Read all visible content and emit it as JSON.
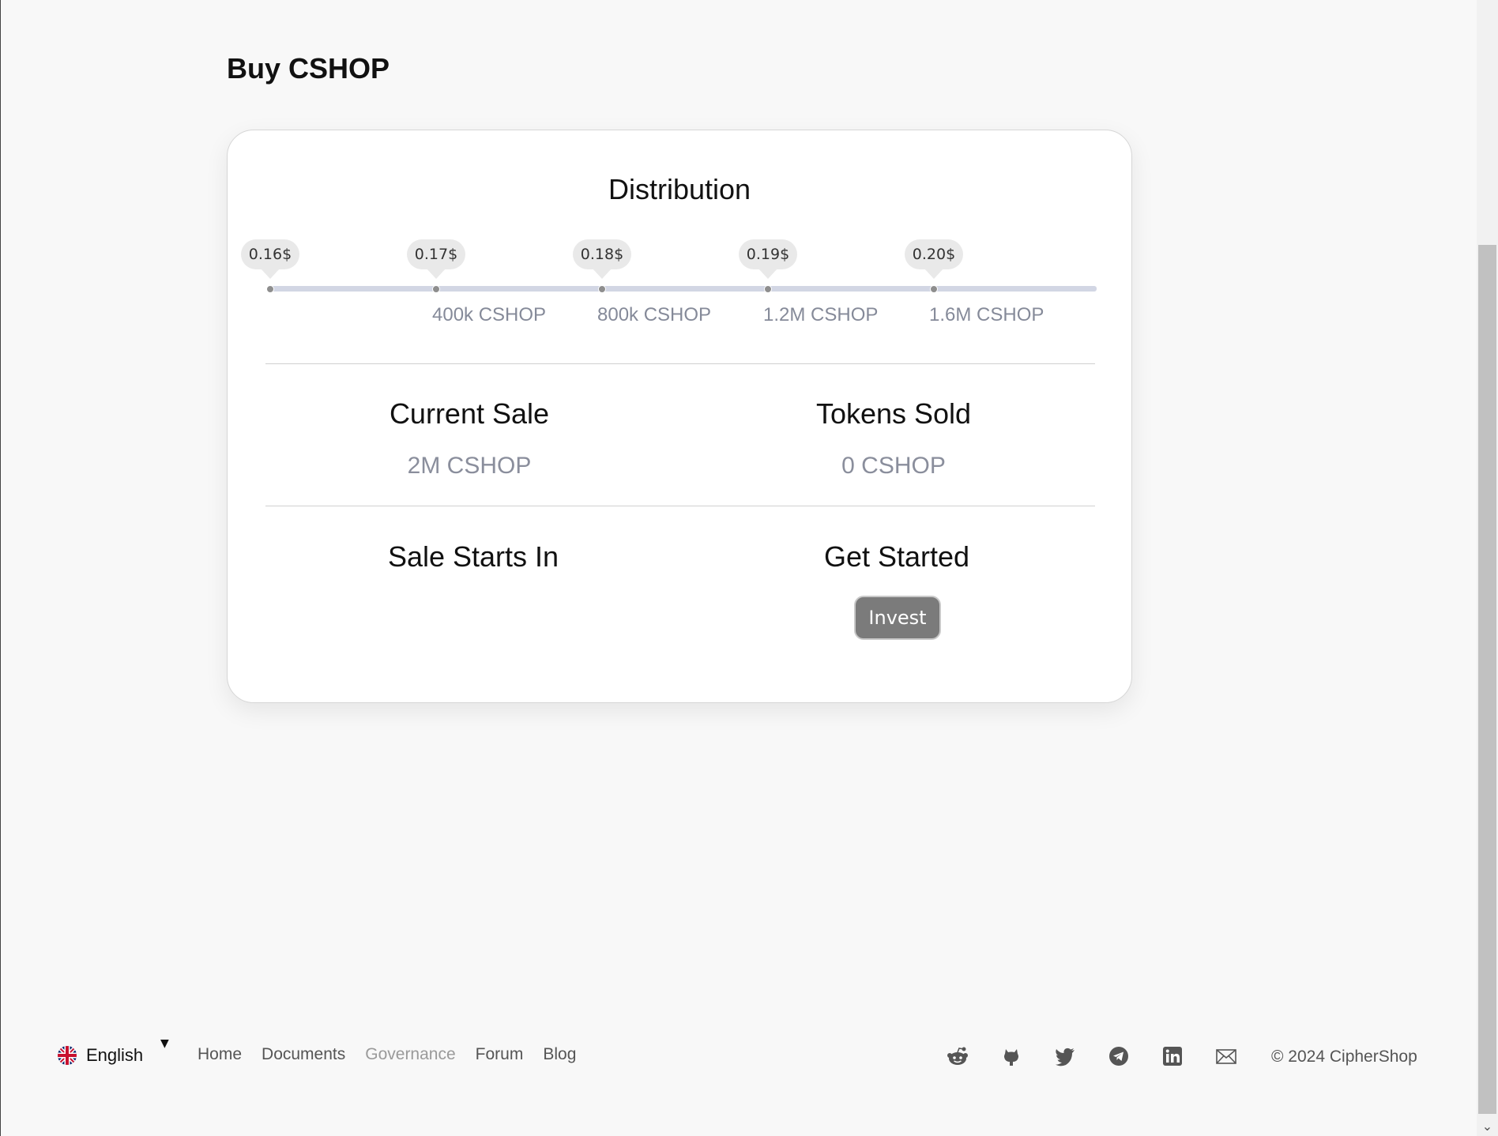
{
  "page": {
    "title": "Buy CSHOP"
  },
  "distribution": {
    "title": "Distribution",
    "stops": [
      {
        "price": "0.16$",
        "label": ""
      },
      {
        "price": "0.17$",
        "label": "400k CSHOP"
      },
      {
        "price": "0.18$",
        "label": "800k CSHOP"
      },
      {
        "price": "0.19$",
        "label": "1.2M CSHOP"
      },
      {
        "price": "0.20$",
        "label": "1.6M CSHOP"
      }
    ]
  },
  "stats": {
    "current_sale": {
      "heading": "Current Sale",
      "value": "2M CSHOP"
    },
    "tokens_sold": {
      "heading": "Tokens Sold",
      "value": "0 CSHOP"
    },
    "sale_starts": {
      "heading": "Sale Starts In",
      "value": ""
    },
    "get_started": {
      "heading": "Get Started",
      "button": "Invest"
    }
  },
  "footer": {
    "language": "English",
    "nav": [
      "Home",
      "Documents",
      "Governance",
      "Forum",
      "Blog"
    ],
    "socials": [
      "reddit-icon",
      "github-icon",
      "twitter-icon",
      "telegram-icon",
      "linkedin-icon",
      "email-icon"
    ],
    "copyright": "© 2024 CipherShop"
  }
}
